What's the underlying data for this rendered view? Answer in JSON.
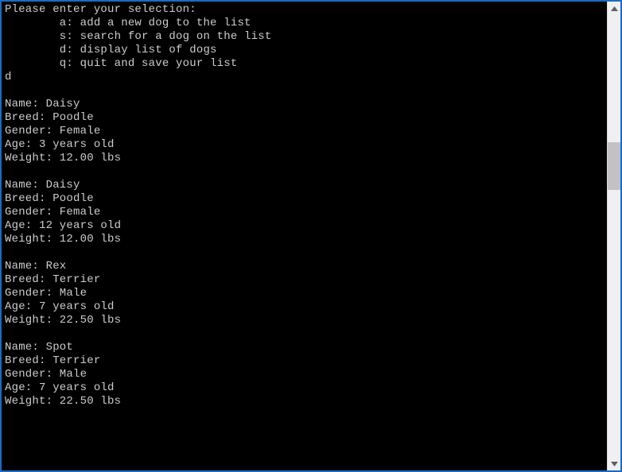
{
  "menu": {
    "prompt": "Please enter your selection:",
    "options": [
      {
        "key": "a",
        "desc": "add a new dog to the list"
      },
      {
        "key": "s",
        "desc": "search for a dog on the list"
      },
      {
        "key": "d",
        "desc": "display list of dogs"
      },
      {
        "key": "q",
        "desc": "quit and save your list"
      }
    ]
  },
  "user_input": "d",
  "field_labels": {
    "name": "Name",
    "breed": "Breed",
    "gender": "Gender",
    "age": "Age",
    "weight": "Weight",
    "age_suffix": "years old",
    "weight_suffix": "lbs"
  },
  "dogs": [
    {
      "name": "Daisy",
      "breed": "Poodle",
      "gender": "Female",
      "age": "3",
      "weight": "12.00"
    },
    {
      "name": "Daisy",
      "breed": "Poodle",
      "gender": "Female",
      "age": "12",
      "weight": "12.00"
    },
    {
      "name": "Rex",
      "breed": "Terrier",
      "gender": "Male",
      "age": "7",
      "weight": "22.50"
    },
    {
      "name": "Spot",
      "breed": "Terrier",
      "gender": "Male",
      "age": "7",
      "weight": "22.50"
    }
  ]
}
